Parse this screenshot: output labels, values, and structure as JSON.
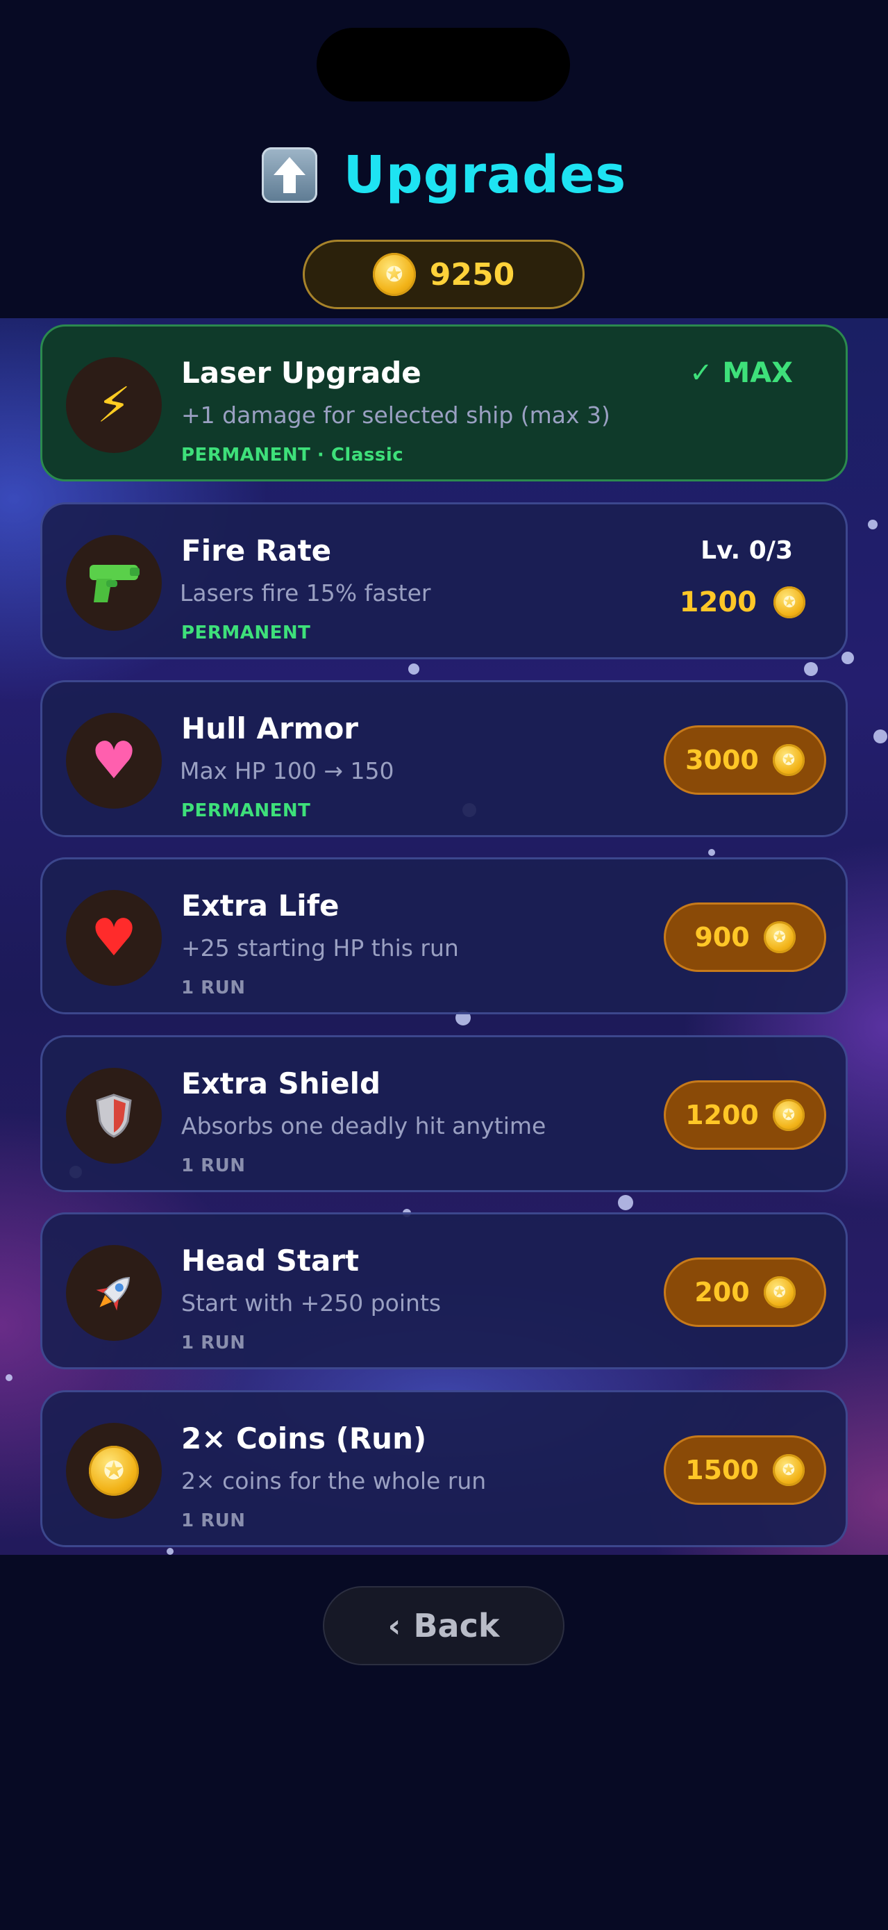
{
  "header": {
    "title": "Upgrades",
    "title_icon": "up-arrow-icon",
    "coins": "9250",
    "coin_glyph": "✪"
  },
  "upgrades": [
    {
      "title": "Laser Upgrade",
      "description": "+1 damage for selected ship (max 3)",
      "tag": "PERMANENT · Classic",
      "icon": "lightning-icon",
      "icon_glyph": "⚡",
      "status": "✓ MAX"
    },
    {
      "title": "Fire Rate",
      "description": "Lasers fire 15% faster",
      "tag": "PERMANENT",
      "icon": "water-pistol-icon",
      "level": "Lv. 0/3",
      "price": "1200"
    },
    {
      "title": "Hull Armor",
      "description": "Max HP 100 → 150",
      "tag": "PERMANENT",
      "icon": "pink-heart-icon",
      "icon_glyph": "♥",
      "price": "3000"
    },
    {
      "title": "Extra Life",
      "description": "+25 starting HP this run",
      "tag": "1 RUN",
      "icon": "red-heart-icon",
      "icon_glyph": "♥",
      "price": "900"
    },
    {
      "title": "Extra Shield",
      "description": "Absorbs one deadly hit anytime",
      "tag": "1 RUN",
      "icon": "shield-icon",
      "price": "1200"
    },
    {
      "title": "Head Start",
      "description": "Start with +250 points",
      "tag": "1 RUN",
      "icon": "rocket-icon",
      "price": "200"
    },
    {
      "title": "2× Coins (Run)",
      "description": "2× coins for the whole run",
      "tag": "1 RUN",
      "icon": "coin-icon",
      "icon_glyph": "✪",
      "price": "1500"
    }
  ],
  "back": {
    "chevron": "‹",
    "label": "Back"
  },
  "colors": {
    "accent": "#1ee3f2",
    "gold": "#ffc727",
    "green": "#3ee07a",
    "background": "#070a24"
  }
}
